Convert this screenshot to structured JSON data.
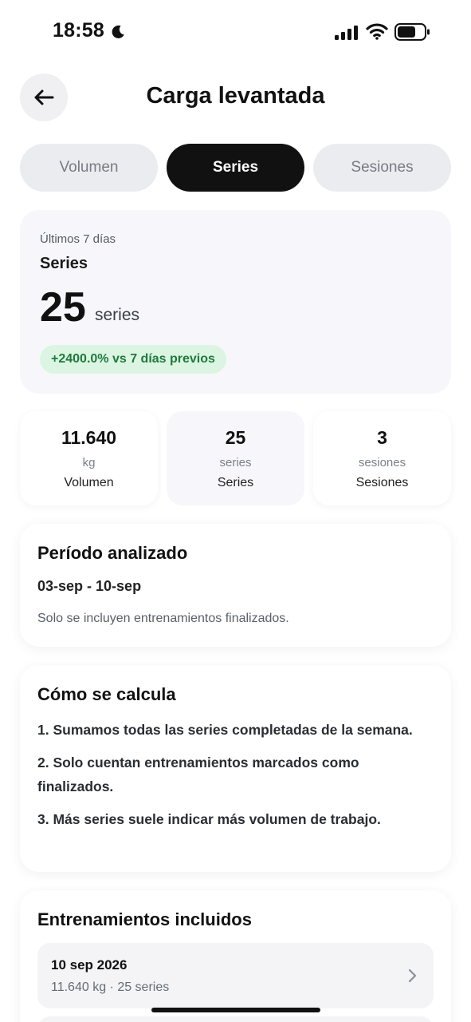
{
  "status_bar": {
    "time": "18:58",
    "icons": [
      "moon-icon",
      "signal-icon",
      "wifi-icon",
      "battery-icon"
    ]
  },
  "header": {
    "title": "Carga levantada",
    "back_icon": "arrow-left-icon"
  },
  "tabs": [
    {
      "label": "Volumen",
      "active": false
    },
    {
      "label": "Series",
      "active": true
    },
    {
      "label": "Sesiones",
      "active": false
    }
  ],
  "summary": {
    "period": "Últimos 7 días",
    "metric": "Series",
    "value": "25",
    "unit": "series",
    "change": "+2400.0% vs 7 días previos"
  },
  "stats": [
    {
      "value": "11.640",
      "unit": "kg",
      "label": "Volumen"
    },
    {
      "value": "25",
      "unit": "series",
      "label": "Series"
    },
    {
      "value": "3",
      "unit": "sesiones",
      "label": "Sesiones"
    }
  ],
  "periodo": {
    "title": "Período analizado",
    "range": "03-sep - 10-sep",
    "note": "Solo se incluyen entrenamientos finalizados."
  },
  "calculo": {
    "title": "Cómo se calcula",
    "steps": [
      "1. Sumamos todas las series completadas de la semana.",
      "2. Solo cuentan entrenamientos marcados como finalizados.",
      "3. Más series suele indicar más volumen de trabajo."
    ]
  },
  "entrenamientos": {
    "title": "Entrenamientos incluidos",
    "items": [
      {
        "date": "10 sep 2026",
        "meta": "11.640 kg · 25 series"
      }
    ]
  },
  "colors": {
    "accent": "#111111",
    "tab_inactive_bg": "#ebecef",
    "badge_bg": "#dcf5e3",
    "badge_text": "#1f7a3c",
    "card_tint": "#f7f7fb"
  }
}
